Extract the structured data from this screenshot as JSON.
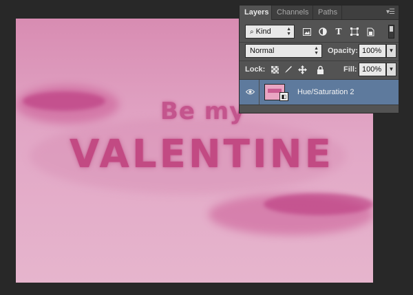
{
  "canvas": {
    "text_line1": "Be my",
    "text_line2": "VALENTINE"
  },
  "layers_panel": {
    "tabs": [
      "Layers",
      "Channels",
      "Paths"
    ],
    "active_tab": "Layers",
    "filter_type": "Kind",
    "blend_mode": "Normal",
    "opacity_label": "Opacity:",
    "opacity_value": "100%",
    "lock_label": "Lock:",
    "fill_label": "Fill:",
    "fill_value": "100%",
    "filter_icons": [
      "image-filter-icon",
      "adjustment-filter-icon",
      "type-filter-icon",
      "shape-filter-icon",
      "smart-object-filter-icon"
    ],
    "lock_icons": [
      "lock-transparent-icon",
      "lock-image-icon",
      "lock-position-icon",
      "lock-all-icon"
    ],
    "layers": [
      {
        "name": "Hue/Saturation 2",
        "visible": true,
        "selected": true
      }
    ]
  },
  "colors": {
    "selection": "#5e7a9d",
    "panel": "#535353",
    "workspace": "#282828",
    "text_pink": "#c0447f"
  }
}
